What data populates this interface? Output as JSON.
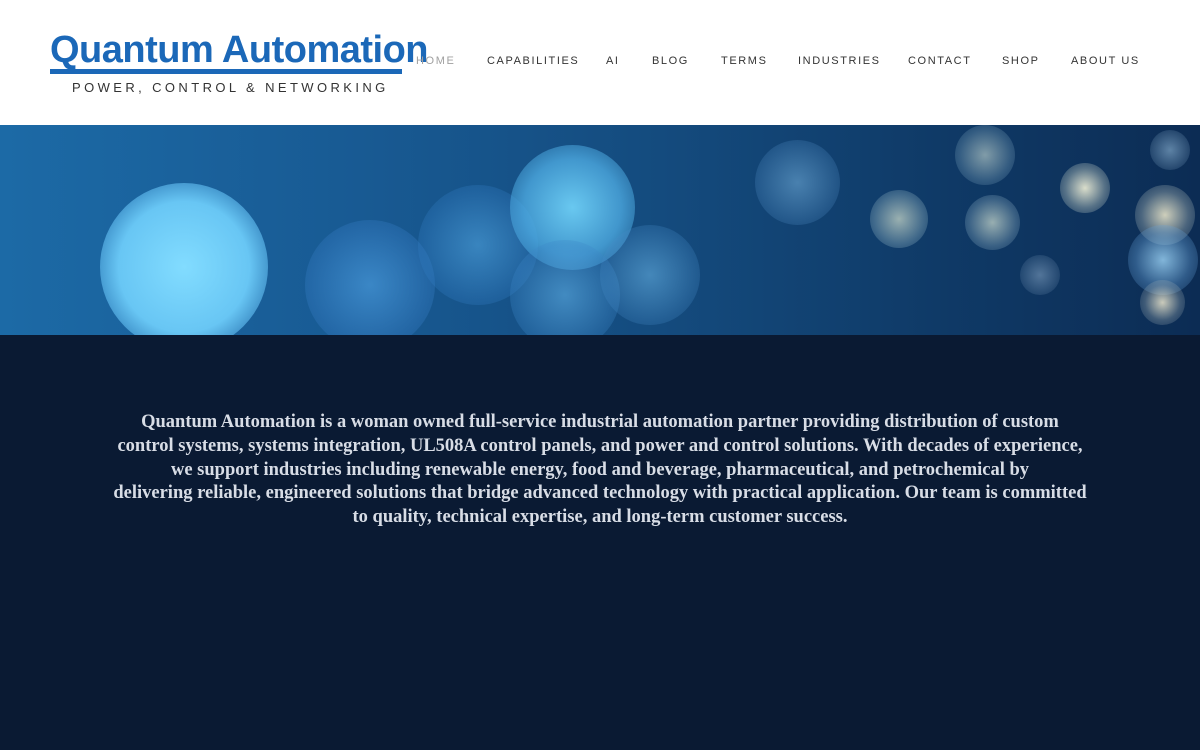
{
  "brand": {
    "name": "Quantum Automation",
    "tagline": "POWER, CONTROL & NETWORKING",
    "color": "#1b68b8"
  },
  "nav": {
    "items": [
      {
        "label": "HOME",
        "active": true
      },
      {
        "label": "CAPABILITIES",
        "active": false
      },
      {
        "label": "AI",
        "active": false
      },
      {
        "label": "BLOG",
        "active": false
      },
      {
        "label": "TERMS",
        "active": false
      },
      {
        "label": "INDUSTRIES",
        "active": false
      },
      {
        "label": "CONTACT",
        "active": false
      },
      {
        "label": "SHOP",
        "active": false
      },
      {
        "label": "ABOUT US",
        "active": false
      }
    ]
  },
  "main": {
    "intro_lines": [
      "Quantum Automation is a woman owned full-service industrial automation partner providing distribution of custom",
      "control systems, systems integration, UL508A control panels, and power and control solutions. With decades of experience,",
      "we support industries including renewable energy, food and beverage, pharmaceutical, and petrochemical by",
      "delivering reliable, engineered solutions that bridge advanced technology with practical application. Our team is committed",
      "to quality, technical expertise, and long-term customer success."
    ],
    "background_color": "#0a1a33"
  }
}
